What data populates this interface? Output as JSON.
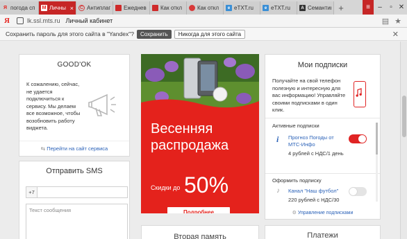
{
  "browser": {
    "tabs": [
      {
        "label": "погода сп",
        "icon": "yandex-icon",
        "favicon_color": "#e52620",
        "active": false
      },
      {
        "label": "Личны",
        "icon": "mts-icon",
        "favicon_color": "#e52620",
        "active": true
      },
      {
        "label": "Антиплаг",
        "icon": "antiplagiat-icon",
        "favicon_color": "#d43b3b",
        "active": false
      },
      {
        "label": "Ежеднев",
        "icon": "news-icon",
        "favicon_color": "#cf2a2a",
        "active": false
      },
      {
        "label": "Как откл",
        "icon": "news-icon",
        "favicon_color": "#cf2a2a",
        "active": false
      },
      {
        "label": "Как откл",
        "icon": "circle-icon",
        "favicon_color": "#d83a3a",
        "active": false
      },
      {
        "label": "eTXT.ru",
        "icon": "etxt-icon",
        "favicon_color": "#3a8fd6",
        "active": false
      },
      {
        "label": "eTXT.ru",
        "icon": "etxt-icon",
        "favicon_color": "#3a8fd6",
        "active": false
      },
      {
        "label": "Семантик",
        "icon": "semantic-icon",
        "favicon_color": "#333333",
        "active": false
      }
    ],
    "address": {
      "logo": "Я",
      "url": "lk.ssl.mts.ru",
      "page_title": "Личный кабинет"
    },
    "password_bar": {
      "text": "Сохранить пароль для этого сайта в \"Yandex\"?",
      "save_label": "Сохранить",
      "never_label": "Никогда для этого сайта"
    }
  },
  "goodok": {
    "title": "GOOD'OK",
    "message": "К сожалению, сейчас, не удается подключиться к сервису. Мы делаем все возможное, чтобы возобновить работу виджета.",
    "link": "Перейти на сайт сервиса"
  },
  "sms": {
    "title": "Отправить SMS",
    "prefix": "+7",
    "text_placeholder": "Текст сообщения"
  },
  "ad": {
    "line1": "Весенняя",
    "line2": "распродажа",
    "discount_label": "Скидки до",
    "discount_value": "50%",
    "button": "Подробнее",
    "colors": {
      "background": "#e4221c",
      "accent": "#ffffff"
    }
  },
  "memory": {
    "title": "Вторая память"
  },
  "subscriptions": {
    "title": "Мои подписки",
    "intro": "Получайте на свой телефон полезную и интересную для вас информацию! Управляйте своими подписками в один клик.",
    "active_header": "Активные подписки",
    "active": [
      {
        "name": "Прогноз Погоды от МТС-Инфо",
        "price_value": "4",
        "price_unit": "рублей с НДС/1 день",
        "enabled": true
      }
    ],
    "offer_header": "Оформить подписку",
    "offers": [
      {
        "name": "Канал \"Наш футбол\"",
        "price_value": "220",
        "price_unit": "рублей с НДС/30",
        "enabled": false
      }
    ],
    "manage_link": "Управление подписками"
  },
  "payments": {
    "title": "Платежи"
  }
}
